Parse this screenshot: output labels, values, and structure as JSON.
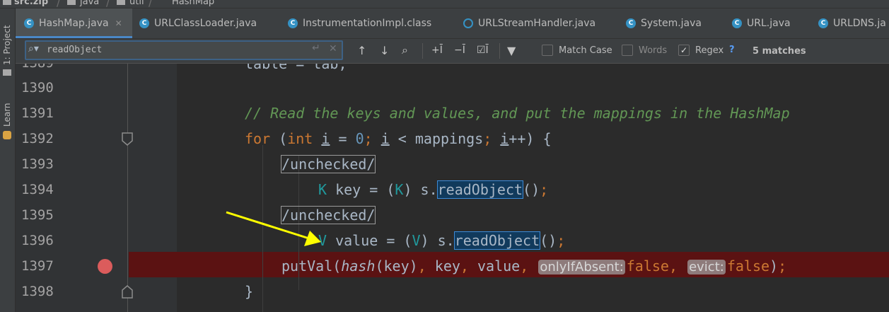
{
  "breadcrumb": [
    "src.zip",
    "java",
    "util",
    "HashMap"
  ],
  "toolwindows": {
    "project": "1: Project",
    "learn": "Learn"
  },
  "tabs": [
    {
      "label": "HashMap.java",
      "active": true,
      "closable": true
    },
    {
      "label": "URLClassLoader.java"
    },
    {
      "label": "InstrumentationImpl.class"
    },
    {
      "label": "URLStreamHandler.java"
    },
    {
      "label": "System.java"
    },
    {
      "label": "URL.java"
    },
    {
      "label": "URLDNS.ja"
    }
  ],
  "search": {
    "query": "readObject",
    "match_case_label": "Match Case",
    "match_case": false,
    "words_label": "Words",
    "words": false,
    "regex_label": "Regex",
    "regex": true,
    "help": "?",
    "match_count": "5 matches"
  },
  "colors": {
    "accent": "#4a88c7",
    "breakpoint": "#db5c5c",
    "breakpoint_line": "#5b1212",
    "match_highlight": "#113a5c"
  },
  "editor": {
    "line_numbers": [
      "1389",
      "1390",
      "1391",
      "1392",
      "1393",
      "1394",
      "1395",
      "1396",
      "1397",
      "1398"
    ],
    "top_line_partial": "table = tab;",
    "comment": "// Read the keys and values, and put the mappings in the HashMap",
    "for_kw": "for",
    "int_kw": "int",
    "loop_var": "i",
    "zero": "0",
    "mappings": "mappings",
    "unchecked": "/unchecked/",
    "key_type": "K",
    "key_name": "key",
    "value_type": "V",
    "value_name": "value",
    "stream": "s.",
    "read_method": "readObject",
    "putval": "putVal",
    "hash_fn": "hash",
    "hint_if_absent": "onlyIfAbsent:",
    "hint_evict": "evict:",
    "false_kw": "false",
    "close_brace": "}",
    "breakpoint_line": "1397"
  }
}
